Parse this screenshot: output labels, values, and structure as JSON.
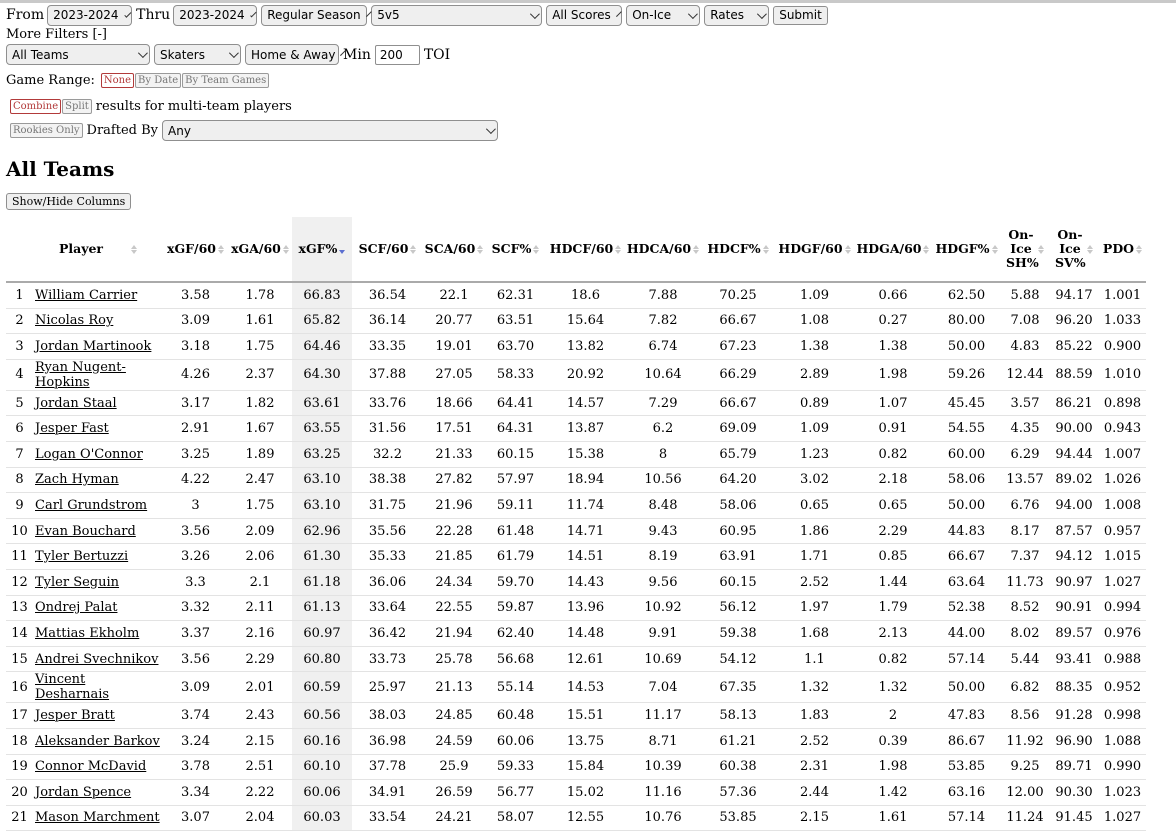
{
  "filters": {
    "from_label": "From",
    "from_value": "2023-2024",
    "thru_label": "Thru",
    "thru_value": "2023-2024",
    "season_type": "Regular Season",
    "strength": "5v5",
    "score": "All Scores",
    "on_ice": "On-Ice",
    "rates": "Rates",
    "submit": "Submit",
    "more_filters": "More Filters [-]",
    "team": "All Teams",
    "position": "Skaters",
    "venue": "Home & Away",
    "min_label": "Min",
    "min_value": "200",
    "toi_label": "TOI",
    "game_range_label": "Game Range:",
    "range_none": "None",
    "range_by_date": "By Date",
    "range_by_team_games": "By Team Games",
    "combine": "Combine",
    "split": "Split",
    "multi_team_text": "results for multi-team players",
    "rookies_only": "Rookies Only",
    "drafted_by_label": "Drafted By",
    "drafted_by_value": "Any"
  },
  "page_title": "All Teams",
  "show_hide": "Show/Hide Columns",
  "table": {
    "headers": [
      "Player",
      "xGF/60",
      "xGA/60",
      "xGF%",
      "SCF/60",
      "SCA/60",
      "SCF%",
      "HDCF/60",
      "HDCA/60",
      "HDCF%",
      "HDGF/60",
      "HDGA/60",
      "HDGF%",
      "On-Ice SH%",
      "On-Ice SV%",
      "PDO"
    ],
    "sorted_column": "xGF%",
    "rows": [
      [
        "1",
        "William Carrier",
        "3.58",
        "1.78",
        "66.83",
        "36.54",
        "22.1",
        "62.31",
        "18.6",
        "7.88",
        "70.25",
        "1.09",
        "0.66",
        "62.50",
        "5.88",
        "94.17",
        "1.001"
      ],
      [
        "2",
        "Nicolas Roy",
        "3.09",
        "1.61",
        "65.82",
        "36.14",
        "20.77",
        "63.51",
        "15.64",
        "7.82",
        "66.67",
        "1.08",
        "0.27",
        "80.00",
        "7.08",
        "96.20",
        "1.033"
      ],
      [
        "3",
        "Jordan Martinook",
        "3.18",
        "1.75",
        "64.46",
        "33.35",
        "19.01",
        "63.70",
        "13.82",
        "6.74",
        "67.23",
        "1.38",
        "1.38",
        "50.00",
        "4.83",
        "85.22",
        "0.900"
      ],
      [
        "4",
        "Ryan Nugent-Hopkins",
        "4.26",
        "2.37",
        "64.30",
        "37.88",
        "27.05",
        "58.33",
        "20.92",
        "10.64",
        "66.29",
        "2.89",
        "1.98",
        "59.26",
        "12.44",
        "88.59",
        "1.010"
      ],
      [
        "5",
        "Jordan Staal",
        "3.17",
        "1.82",
        "63.61",
        "33.76",
        "18.66",
        "64.41",
        "14.57",
        "7.29",
        "66.67",
        "0.89",
        "1.07",
        "45.45",
        "3.57",
        "86.21",
        "0.898"
      ],
      [
        "6",
        "Jesper Fast",
        "2.91",
        "1.67",
        "63.55",
        "31.56",
        "17.51",
        "64.31",
        "13.87",
        "6.2",
        "69.09",
        "1.09",
        "0.91",
        "54.55",
        "4.35",
        "90.00",
        "0.943"
      ],
      [
        "7",
        "Logan O'Connor",
        "3.25",
        "1.89",
        "63.25",
        "32.2",
        "21.33",
        "60.15",
        "15.38",
        "8",
        "65.79",
        "1.23",
        "0.82",
        "60.00",
        "6.29",
        "94.44",
        "1.007"
      ],
      [
        "8",
        "Zach Hyman",
        "4.22",
        "2.47",
        "63.10",
        "38.38",
        "27.82",
        "57.97",
        "18.94",
        "10.56",
        "64.20",
        "3.02",
        "2.18",
        "58.06",
        "13.57",
        "89.02",
        "1.026"
      ],
      [
        "9",
        "Carl Grundstrom",
        "3",
        "1.75",
        "63.10",
        "31.75",
        "21.96",
        "59.11",
        "11.74",
        "8.48",
        "58.06",
        "0.65",
        "0.65",
        "50.00",
        "6.76",
        "94.00",
        "1.008"
      ],
      [
        "10",
        "Evan Bouchard",
        "3.56",
        "2.09",
        "62.96",
        "35.56",
        "22.28",
        "61.48",
        "14.71",
        "9.43",
        "60.95",
        "1.86",
        "2.29",
        "44.83",
        "8.17",
        "87.57",
        "0.957"
      ],
      [
        "11",
        "Tyler Bertuzzi",
        "3.26",
        "2.06",
        "61.30",
        "35.33",
        "21.85",
        "61.79",
        "14.51",
        "8.19",
        "63.91",
        "1.71",
        "0.85",
        "66.67",
        "7.37",
        "94.12",
        "1.015"
      ],
      [
        "12",
        "Tyler Seguin",
        "3.3",
        "2.1",
        "61.18",
        "36.06",
        "24.34",
        "59.70",
        "14.43",
        "9.56",
        "60.15",
        "2.52",
        "1.44",
        "63.64",
        "11.73",
        "90.97",
        "1.027"
      ],
      [
        "13",
        "Ondrej Palat",
        "3.32",
        "2.11",
        "61.13",
        "33.64",
        "22.55",
        "59.87",
        "13.96",
        "10.92",
        "56.12",
        "1.97",
        "1.79",
        "52.38",
        "8.52",
        "90.91",
        "0.994"
      ],
      [
        "14",
        "Mattias Ekholm",
        "3.37",
        "2.16",
        "60.97",
        "36.42",
        "21.94",
        "62.40",
        "14.48",
        "9.91",
        "59.38",
        "1.68",
        "2.13",
        "44.00",
        "8.02",
        "89.57",
        "0.976"
      ],
      [
        "15",
        "Andrei Svechnikov",
        "3.56",
        "2.29",
        "60.80",
        "33.73",
        "25.78",
        "56.68",
        "12.61",
        "10.69",
        "54.12",
        "1.1",
        "0.82",
        "57.14",
        "5.44",
        "93.41",
        "0.988"
      ],
      [
        "16",
        "Vincent Desharnais",
        "3.09",
        "2.01",
        "60.59",
        "25.97",
        "21.13",
        "55.14",
        "14.53",
        "7.04",
        "67.35",
        "1.32",
        "1.32",
        "50.00",
        "6.82",
        "88.35",
        "0.952"
      ],
      [
        "17",
        "Jesper Bratt",
        "3.74",
        "2.43",
        "60.56",
        "38.03",
        "24.85",
        "60.48",
        "15.51",
        "11.17",
        "58.13",
        "1.83",
        "2",
        "47.83",
        "8.56",
        "91.28",
        "0.998"
      ],
      [
        "18",
        "Aleksander Barkov",
        "3.24",
        "2.15",
        "60.16",
        "36.98",
        "24.59",
        "60.06",
        "13.75",
        "8.71",
        "61.21",
        "2.52",
        "0.39",
        "86.67",
        "11.92",
        "96.90",
        "1.088"
      ],
      [
        "19",
        "Connor McDavid",
        "3.78",
        "2.51",
        "60.10",
        "37.78",
        "25.9",
        "59.33",
        "15.84",
        "10.39",
        "60.38",
        "2.31",
        "1.98",
        "53.85",
        "9.25",
        "89.71",
        "0.990"
      ],
      [
        "20",
        "Jordan Spence",
        "3.34",
        "2.22",
        "60.06",
        "34.91",
        "26.59",
        "56.77",
        "15.02",
        "11.16",
        "57.36",
        "2.44",
        "1.42",
        "63.16",
        "12.00",
        "90.30",
        "1.023"
      ],
      [
        "21",
        "Mason Marchment",
        "3.07",
        "2.04",
        "60.03",
        "33.54",
        "24.21",
        "58.07",
        "12.55",
        "10.76",
        "53.85",
        "2.15",
        "1.61",
        "57.14",
        "11.24",
        "91.45",
        "1.027"
      ]
    ]
  }
}
